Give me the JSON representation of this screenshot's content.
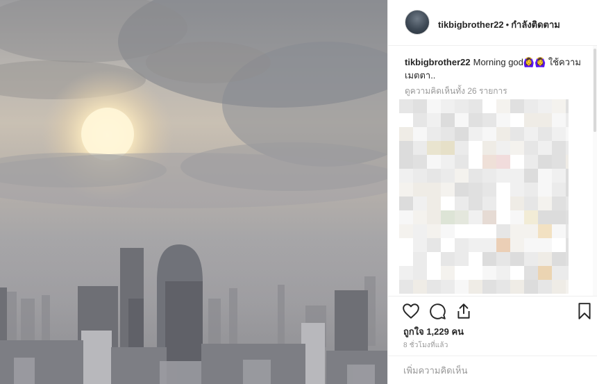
{
  "post": {
    "username": "tikbigbrother22",
    "separator": "•",
    "follow_status": "กำลังติดตาม",
    "caption_text": "Morning god🙆‍♀️🙆‍♀️ ใช้ความ เมตตา..",
    "view_all_comments": "ดูความคิดเห็นทั้ง 26 รายการ",
    "likes_text": "ถูกใจ 1,229 คน",
    "timestamp": "8 ชั่วโมงที่แล้ว",
    "comment_placeholder": "เพิ่มความคิดเห็น"
  },
  "icons": {
    "like": "heart-icon",
    "comment": "comment-bubble-icon",
    "share": "share-icon",
    "save": "bookmark-icon"
  },
  "colors": {
    "text": "#262626",
    "secondary": "#999999",
    "divider": "#efefef"
  }
}
